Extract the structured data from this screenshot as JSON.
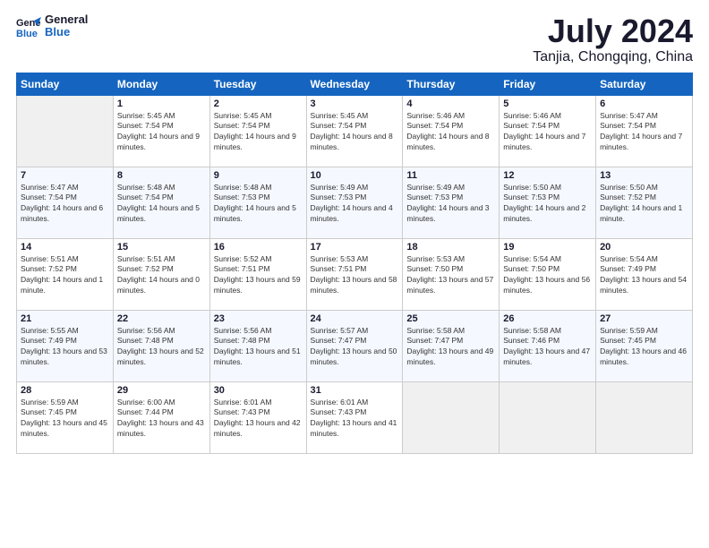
{
  "header": {
    "logo_line1": "General",
    "logo_line2": "Blue",
    "month": "July 2024",
    "location": "Tanjia, Chongqing, China"
  },
  "weekdays": [
    "Sunday",
    "Monday",
    "Tuesday",
    "Wednesday",
    "Thursday",
    "Friday",
    "Saturday"
  ],
  "weeks": [
    [
      {
        "day": "",
        "empty": true
      },
      {
        "day": "1",
        "sunrise": "5:45 AM",
        "sunset": "7:54 PM",
        "daylight": "14 hours and 9 minutes."
      },
      {
        "day": "2",
        "sunrise": "5:45 AM",
        "sunset": "7:54 PM",
        "daylight": "14 hours and 9 minutes."
      },
      {
        "day": "3",
        "sunrise": "5:45 AM",
        "sunset": "7:54 PM",
        "daylight": "14 hours and 8 minutes."
      },
      {
        "day": "4",
        "sunrise": "5:46 AM",
        "sunset": "7:54 PM",
        "daylight": "14 hours and 8 minutes."
      },
      {
        "day": "5",
        "sunrise": "5:46 AM",
        "sunset": "7:54 PM",
        "daylight": "14 hours and 7 minutes."
      },
      {
        "day": "6",
        "sunrise": "5:47 AM",
        "sunset": "7:54 PM",
        "daylight": "14 hours and 7 minutes."
      }
    ],
    [
      {
        "day": "7",
        "sunrise": "5:47 AM",
        "sunset": "7:54 PM",
        "daylight": "14 hours and 6 minutes."
      },
      {
        "day": "8",
        "sunrise": "5:48 AM",
        "sunset": "7:54 PM",
        "daylight": "14 hours and 5 minutes."
      },
      {
        "day": "9",
        "sunrise": "5:48 AM",
        "sunset": "7:53 PM",
        "daylight": "14 hours and 5 minutes."
      },
      {
        "day": "10",
        "sunrise": "5:49 AM",
        "sunset": "7:53 PM",
        "daylight": "14 hours and 4 minutes."
      },
      {
        "day": "11",
        "sunrise": "5:49 AM",
        "sunset": "7:53 PM",
        "daylight": "14 hours and 3 minutes."
      },
      {
        "day": "12",
        "sunrise": "5:50 AM",
        "sunset": "7:53 PM",
        "daylight": "14 hours and 2 minutes."
      },
      {
        "day": "13",
        "sunrise": "5:50 AM",
        "sunset": "7:52 PM",
        "daylight": "14 hours and 1 minute."
      }
    ],
    [
      {
        "day": "14",
        "sunrise": "5:51 AM",
        "sunset": "7:52 PM",
        "daylight": "14 hours and 1 minute."
      },
      {
        "day": "15",
        "sunrise": "5:51 AM",
        "sunset": "7:52 PM",
        "daylight": "14 hours and 0 minutes."
      },
      {
        "day": "16",
        "sunrise": "5:52 AM",
        "sunset": "7:51 PM",
        "daylight": "13 hours and 59 minutes."
      },
      {
        "day": "17",
        "sunrise": "5:53 AM",
        "sunset": "7:51 PM",
        "daylight": "13 hours and 58 minutes."
      },
      {
        "day": "18",
        "sunrise": "5:53 AM",
        "sunset": "7:50 PM",
        "daylight": "13 hours and 57 minutes."
      },
      {
        "day": "19",
        "sunrise": "5:54 AM",
        "sunset": "7:50 PM",
        "daylight": "13 hours and 56 minutes."
      },
      {
        "day": "20",
        "sunrise": "5:54 AM",
        "sunset": "7:49 PM",
        "daylight": "13 hours and 54 minutes."
      }
    ],
    [
      {
        "day": "21",
        "sunrise": "5:55 AM",
        "sunset": "7:49 PM",
        "daylight": "13 hours and 53 minutes."
      },
      {
        "day": "22",
        "sunrise": "5:56 AM",
        "sunset": "7:48 PM",
        "daylight": "13 hours and 52 minutes."
      },
      {
        "day": "23",
        "sunrise": "5:56 AM",
        "sunset": "7:48 PM",
        "daylight": "13 hours and 51 minutes."
      },
      {
        "day": "24",
        "sunrise": "5:57 AM",
        "sunset": "7:47 PM",
        "daylight": "13 hours and 50 minutes."
      },
      {
        "day": "25",
        "sunrise": "5:58 AM",
        "sunset": "7:47 PM",
        "daylight": "13 hours and 49 minutes."
      },
      {
        "day": "26",
        "sunrise": "5:58 AM",
        "sunset": "7:46 PM",
        "daylight": "13 hours and 47 minutes."
      },
      {
        "day": "27",
        "sunrise": "5:59 AM",
        "sunset": "7:45 PM",
        "daylight": "13 hours and 46 minutes."
      }
    ],
    [
      {
        "day": "28",
        "sunrise": "5:59 AM",
        "sunset": "7:45 PM",
        "daylight": "13 hours and 45 minutes."
      },
      {
        "day": "29",
        "sunrise": "6:00 AM",
        "sunset": "7:44 PM",
        "daylight": "13 hours and 43 minutes."
      },
      {
        "day": "30",
        "sunrise": "6:01 AM",
        "sunset": "7:43 PM",
        "daylight": "13 hours and 42 minutes."
      },
      {
        "day": "31",
        "sunrise": "6:01 AM",
        "sunset": "7:43 PM",
        "daylight": "13 hours and 41 minutes."
      },
      {
        "day": "",
        "empty": true
      },
      {
        "day": "",
        "empty": true
      },
      {
        "day": "",
        "empty": true
      }
    ]
  ]
}
